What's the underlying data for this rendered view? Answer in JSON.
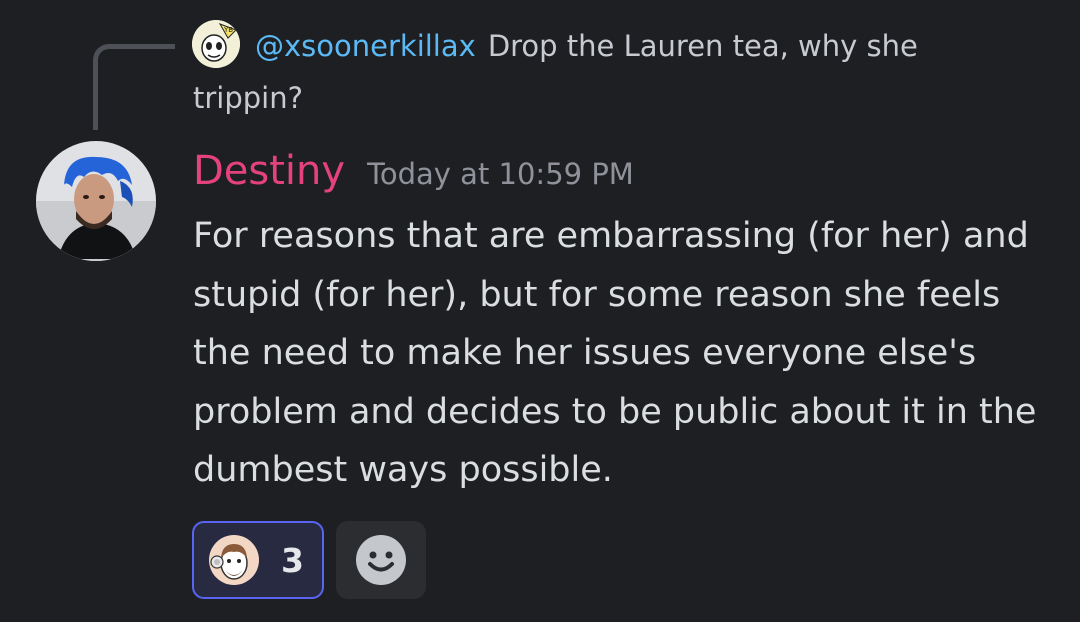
{
  "reply": {
    "username": "@xsoonerkillax",
    "text": "Drop the Lauren tea, why she trippin?",
    "avatar_badge": "YB"
  },
  "message": {
    "author": "Destiny",
    "timestamp": "Today at 10:59 PM",
    "content": "For reasons that are embarrassing (for her) and stupid (for her), but for some reason she feels the need to make her issues everyone else's problem and decides to be public about it in the dumbest ways possible."
  },
  "reactions": [
    {
      "emoji": "custom-face-emoji",
      "count": "3",
      "reacted": true
    }
  ],
  "add_reaction_icon": "smiley-face-icon",
  "colors": {
    "background": "#1e1f22",
    "author_name": "#e4427d",
    "mention": "#5bb9f5",
    "reaction_border": "#5865f2"
  }
}
